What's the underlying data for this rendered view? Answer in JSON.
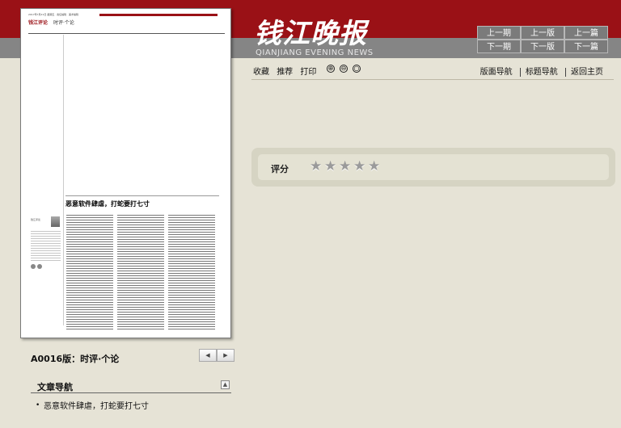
{
  "header": {
    "logo_cn": "钱江晚报",
    "logo_en": "QIANJIANG EVENING NEWS",
    "nav": {
      "prev_issue": "上一期",
      "prev_page": "上一版",
      "prev_article": "上一篇",
      "next_issue": "下一期",
      "next_page": "下一版",
      "next_article": "下一篇"
    },
    "colors": {
      "red": "#9a1116",
      "grey": "#858585"
    }
  },
  "toolbar": {
    "favorite": "收藏",
    "recommend": "推荐",
    "print": "打印",
    "zoom_in_icon": "⊕",
    "zoom_out_icon": "⊖",
    "zoom_reset_icon": "○",
    "layout_nav": "版面导航",
    "title_nav": "标题导航",
    "home": "返回主页"
  },
  "rating": {
    "label": "评分",
    "max_stars": 5,
    "value": 0,
    "star_glyph": "★"
  },
  "paper": {
    "dateline": "2017年7月21日 星期五 · 责任编辑 · 美术编辑",
    "masthead": "钱江评论",
    "section": "时评·个论",
    "headline": "恶意软件肆虐，打蛇要打七寸",
    "col_name": "钱江评论"
  },
  "page_info": {
    "label": "A0016版：时评·个论",
    "prev_icon": "◀",
    "next_icon": "▶"
  },
  "article_nav": {
    "title": "文章导航",
    "collapse_icon": "▲",
    "bullet": "•",
    "items": [
      "恶意软件肆虐，打蛇要打七寸"
    ]
  }
}
